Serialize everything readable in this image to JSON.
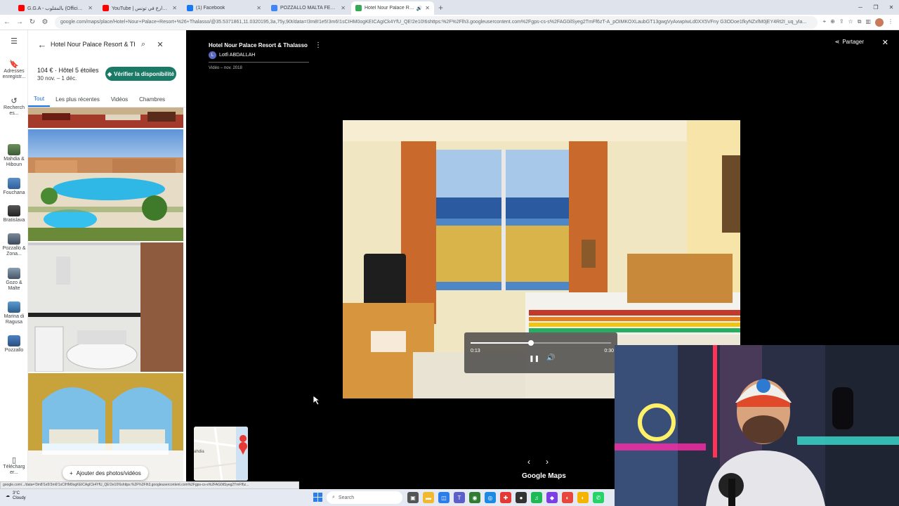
{
  "browser": {
    "tabs": [
      {
        "title": "G.G.A - بالمقلوب (Official Music",
        "color": "#ff0000",
        "active": false
      },
      {
        "title": "YouTube | أكل الشوارع في تونس",
        "color": "#ff0000",
        "active": false
      },
      {
        "title": "(1) Facebook",
        "color": "#1877f2",
        "active": false
      },
      {
        "title": "POZZALLO MALTA FERRY - Goo",
        "color": "#4285f4",
        "active": false
      },
      {
        "title": "Hotel Nour Palace Resort &",
        "color": "#34a853",
        "active": true
      }
    ],
    "url": "google.com/maps/place/Hotel+Nour+Palace+Resort+%26+Thalasso/@35.5371861,11.0320195,3a,75y,90t/data=!3m8!1e5!3m6!1sCIHM0ogKEICAgICk4YfU_QE!2e10!6shttps:%2F%2Flh3.googleusercontent.com%2Fgps-cs-s%2FAG0ilSyeg2TmFf6zT-A_pOIMKOXLaubGT13gwgVyAxwpIwLd0XX5VFny G3ODoe1fkyNZxfM0jEY4Rt2I_uq_yla..."
  },
  "rail": {
    "items": [
      {
        "label": "Adresses enregistr...",
        "icon": "bookmark-icon"
      },
      {
        "label": "Recherch es...",
        "icon": "history-icon"
      },
      {
        "label": "Mahdia & Hiboun"
      },
      {
        "label": "Fouchana"
      },
      {
        "label": "Bratislava"
      },
      {
        "label": "Pozzallo & Zona..."
      },
      {
        "label": "Gozo & Malte"
      },
      {
        "label": "Marina di Ragusa"
      },
      {
        "label": "Pozzallo"
      },
      {
        "label": "Télécharg er...",
        "icon": "phone-icon"
      }
    ]
  },
  "panel": {
    "search_value": "Hotel Nour Palace Resort & Th",
    "price_text": "104 € · Hôtel 5 étoiles",
    "dates_text": "30 nov. – 1 déc.",
    "check_label": "Vérifier la disponibilité",
    "tabs": [
      "Tout",
      "Les plus récentes",
      "Vidéos",
      "Chambres"
    ],
    "add_photos_label": "Ajouter des photos/vidéos"
  },
  "viewer": {
    "title": "Hotel Nour Palace Resort & Thalasso",
    "author": "Lotfi ABDALLAH",
    "author_initial": "L",
    "date_text": "Vidéo – nov. 2018",
    "share_label": "Partager",
    "current_time": "0:13",
    "duration": "0:30",
    "progress_fraction": 0.43,
    "minimap_label": "ahdia",
    "brand": "Google Maps"
  },
  "status_url": "google.com/.../data=!3m8!1e5!3m6!1sCIHM0ogKEICAgICk4YfU_QE!2e10!6shttps:%2F%2Flh3.googleusercontent.com%2Fgps-cs-s%2FAG0ilSyeg2TmFf6z...",
  "taskbar": {
    "weather_temp": "3°C",
    "weather_desc": "Cloudy",
    "search_placeholder": "Search"
  }
}
